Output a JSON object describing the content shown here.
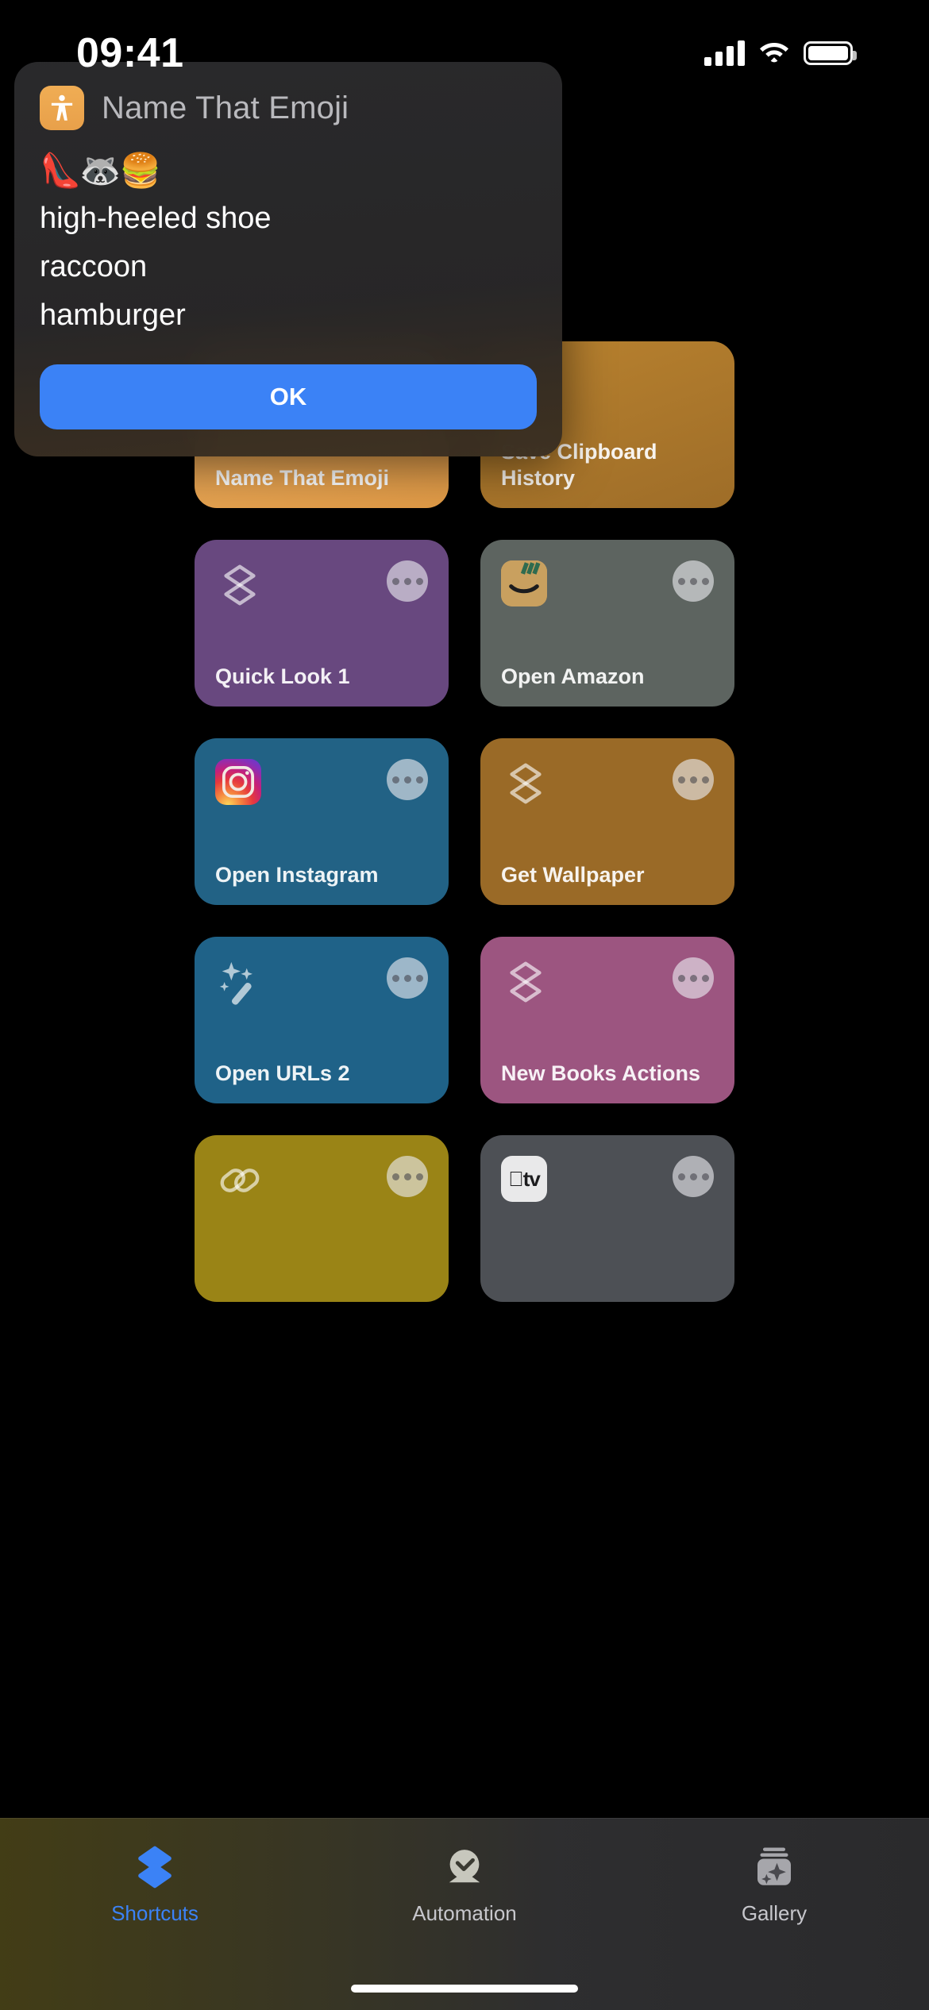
{
  "status_bar": {
    "time": "09:41",
    "signal_icon": "cellular-signal-icon",
    "wifi_icon": "wifi-icon",
    "battery_icon": "battery-icon"
  },
  "alert": {
    "app_icon": "accessibility-person-icon",
    "title": "Name That Emoji",
    "emojis": "👠🦝🍔",
    "lines": [
      "high-heeled shoe",
      "raccoon",
      "hamburger"
    ],
    "ok_label": "OK",
    "ok_color": "#3b82f6"
  },
  "grid": {
    "cards": [
      {
        "title": "Name That Emoji",
        "color": "#eaa450",
        "icon": "shortcuts-layers-icon",
        "dimmed": false,
        "highlight": true
      },
      {
        "title": "Save Clipboard History",
        "color": "#b8802f",
        "icon": "shortcuts-layers-icon",
        "dimmed": true,
        "highlight": false
      },
      {
        "title": "Quick Look 1",
        "color": "#68487f",
        "icon": "shortcuts-layers-icon",
        "dimmed": false,
        "highlight": false
      },
      {
        "title": "Open Amazon",
        "color": "#5d6460",
        "icon": "amazon-app-icon",
        "dimmed": false,
        "highlight": false
      },
      {
        "title": "Open Instagram",
        "color": "#226285",
        "icon": "instagram-app-icon",
        "dimmed": false,
        "highlight": false
      },
      {
        "title": "Get Wallpaper",
        "color": "#9a6a27",
        "icon": "shortcuts-layers-icon",
        "dimmed": false,
        "highlight": false
      },
      {
        "title": "Open URLs 2",
        "color": "#1f6288",
        "icon": "magic-wand-icon",
        "dimmed": false,
        "highlight": false
      },
      {
        "title": "New Books Actions",
        "color": "#9c5580",
        "icon": "shortcuts-layers-icon",
        "dimmed": false,
        "highlight": false
      },
      {
        "title": "",
        "color": "#9a8416",
        "icon": "link-chain-icon",
        "dimmed": false,
        "highlight": false
      },
      {
        "title": "",
        "color": "#4d5055",
        "icon": "apple-tv-app-icon",
        "dimmed": false,
        "highlight": false
      }
    ],
    "more_menu_label": "•••"
  },
  "tab_bar": {
    "tabs": [
      {
        "label": "Shortcuts",
        "icon": "shortcuts-layers-icon",
        "active": true
      },
      {
        "label": "Automation",
        "icon": "automation-clock-icon",
        "active": false
      },
      {
        "label": "Gallery",
        "icon": "gallery-sparkle-icon",
        "active": false
      }
    ],
    "active_color": "#3b82f6"
  },
  "home_indicator": "home-indicator"
}
